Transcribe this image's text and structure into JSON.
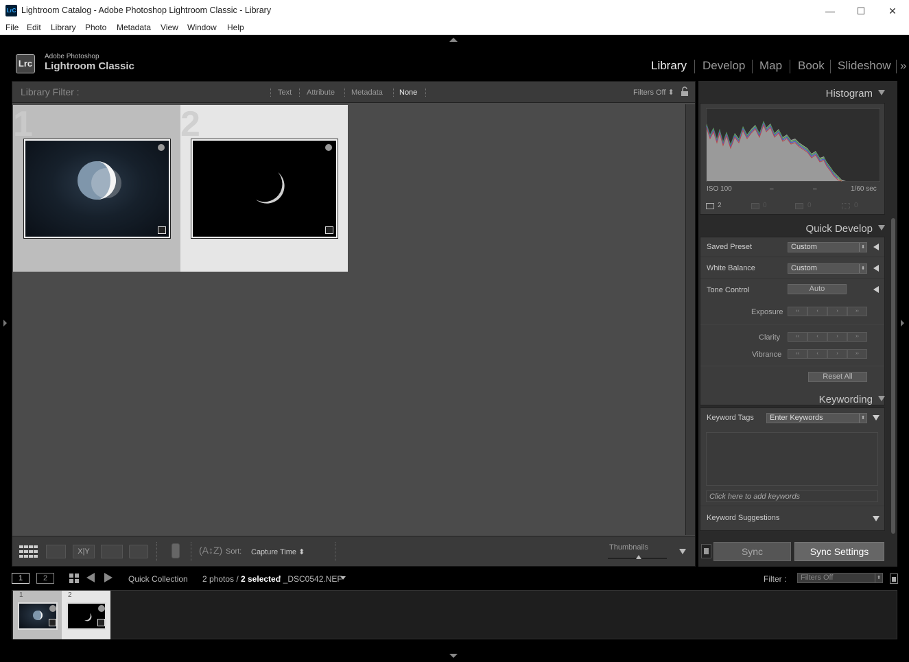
{
  "window": {
    "title": "Lightroom Catalog - Adobe Photoshop Lightroom Classic - Library",
    "icon_label": "LrC",
    "minimize_glyph": "—",
    "maximize_glyph": "☐",
    "close_glyph": "✕"
  },
  "menu": [
    "File",
    "Edit",
    "Library",
    "Photo",
    "Metadata",
    "View",
    "Window",
    "Help"
  ],
  "brand": {
    "logo": "Lrc",
    "line1": "Adobe Photoshop",
    "line2": "Lightroom Classic"
  },
  "modules": [
    "Library",
    "Develop",
    "Map",
    "Book",
    "Slideshow"
  ],
  "modules_more": "»",
  "active_module": "Library",
  "filter_bar": {
    "title": "Library Filter :",
    "options": [
      "Text",
      "Attribute",
      "Metadata",
      "None"
    ],
    "selected": "None",
    "filters_state": "Filters Off ⬍"
  },
  "grid": [
    {
      "index": "1",
      "image": "crescent moon with earthshine",
      "selected": true
    },
    {
      "index": "2",
      "image": "thin crescent moon",
      "selected": false
    }
  ],
  "toolbar": {
    "sort_label": "Sort:",
    "sort_value": "Capture Time ⬍",
    "thumbnails_label": "Thumbnails",
    "xy_label": "X|Y"
  },
  "histogram": {
    "title": "Histogram",
    "iso": "ISO 100",
    "dash1": "–",
    "dash2": "–",
    "shutter": "1/60 sec",
    "count": "2",
    "zero1": "0",
    "zero2": "0",
    "zero3": "0"
  },
  "quick_develop": {
    "title": "Quick Develop",
    "saved_preset_label": "Saved Preset",
    "saved_preset_value": "Custom",
    "white_balance_label": "White Balance",
    "white_balance_value": "Custom",
    "tone_control_label": "Tone Control",
    "auto_label": "Auto",
    "exposure_label": "Exposure",
    "clarity_label": "Clarity",
    "vibrance_label": "Vibrance",
    "reset_label": "Reset All",
    "step_buttons": [
      "‹‹",
      "‹",
      "›",
      "››"
    ]
  },
  "keywording": {
    "title": "Keywording",
    "tags_label": "Keyword Tags",
    "tags_value": "Enter Keywords",
    "add_placeholder": "Click here to add keywords",
    "suggestions_label": "Keyword Suggestions"
  },
  "sync": {
    "sync_label": "Sync",
    "sync_settings_label": "Sync Settings"
  },
  "filmstrip_bar": {
    "page1": "1",
    "page2": "2",
    "source": "Quick Collection",
    "count_text": "2 photos /",
    "selected_text": "2 selected",
    "file_text": "/ _DSC0542.NEF",
    "filter_label": "Filter :",
    "filter_value": "Filters Off"
  },
  "filmstrip": [
    {
      "index": "1",
      "selected": true
    },
    {
      "index": "2",
      "selected": false
    }
  ],
  "colors": {
    "panel_bg": "#3c3c3c",
    "grid_bg": "#4b4b4b",
    "selected_cell": "#bdbdbd",
    "light_cell": "#e6e6e6"
  }
}
